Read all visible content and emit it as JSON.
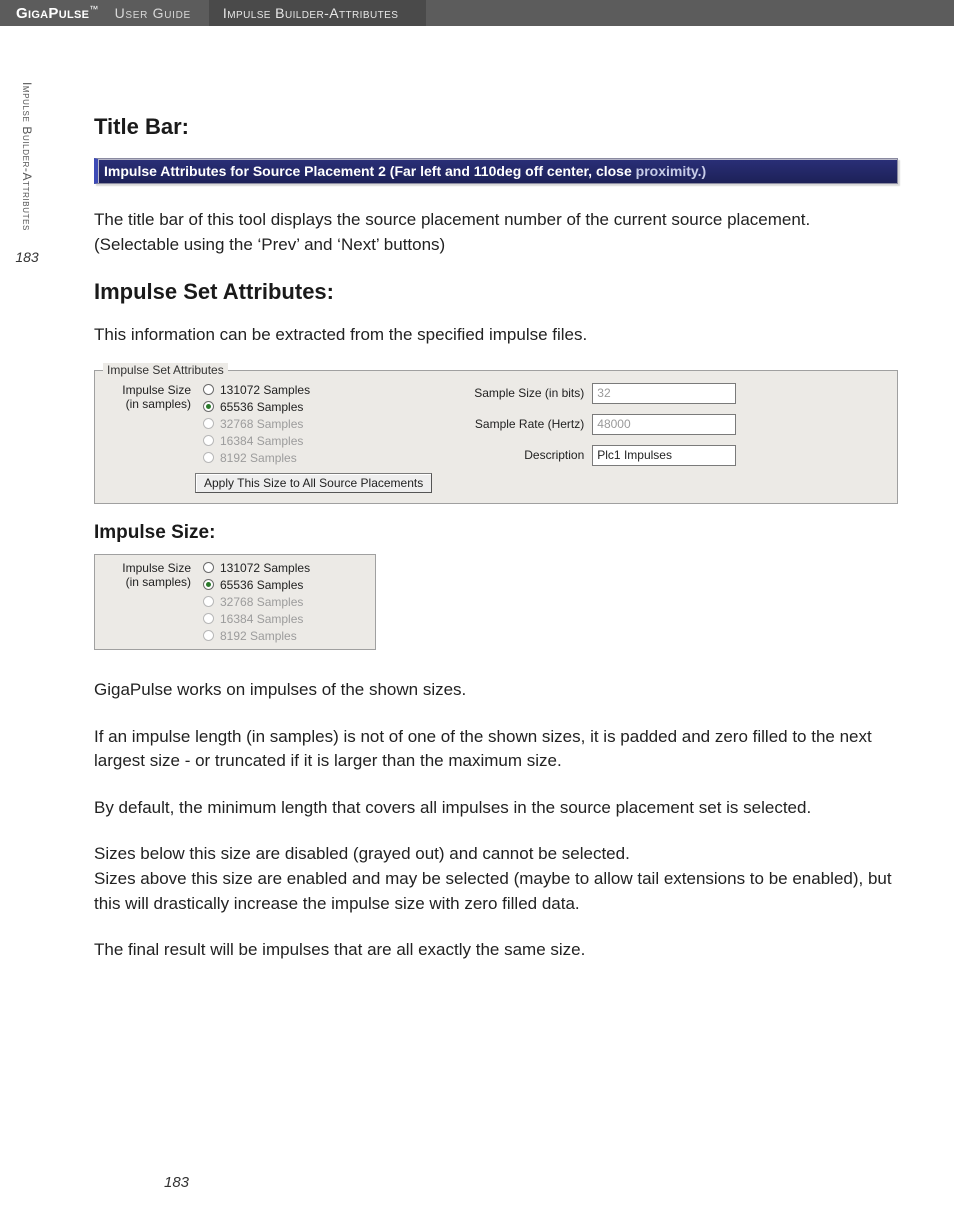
{
  "header": {
    "brand": "GigaPulse",
    "brand_tm": "™",
    "section": "User Guide",
    "crumb": "Impulse Builder-Attributes"
  },
  "gutter": {
    "label": "Impulse Builder-Attributes",
    "page_num": "183"
  },
  "title_bar_section": {
    "heading": "Title Bar:",
    "bar_text_a": "Impulse Attributes for Source Placement 2 (Far left and 110deg off center, close ",
    "bar_text_b": "proximity.)",
    "desc": "The title bar of this tool displays the source placement number of the current source placement. (Selectable using the ‘Prev’ and ‘Next’ buttons)"
  },
  "impulse_set_attr_section": {
    "heading": "Impulse Set Attributes:",
    "intro": "This information can be extracted from the specified impulse files.",
    "groupbox_legend": "Impulse Set Attributes",
    "size_label_line1": "Impulse Size",
    "size_label_line2": "(in samples)",
    "radios": [
      {
        "label": "131072 Samples",
        "selected": false,
        "disabled": false
      },
      {
        "label": "65536 Samples",
        "selected": true,
        "disabled": false
      },
      {
        "label": "32768 Samples",
        "selected": false,
        "disabled": true
      },
      {
        "label": "16384 Samples",
        "selected": false,
        "disabled": true
      },
      {
        "label": "8192 Samples",
        "selected": false,
        "disabled": true
      }
    ],
    "apply_button": "Apply This Size to All Source Placements",
    "field_sample_size_label": "Sample Size (in bits)",
    "field_sample_size_value": "32",
    "field_sample_rate_label": "Sample Rate (Hertz)",
    "field_sample_rate_value": "48000",
    "field_description_label": "Description",
    "field_description_value": "Plc1 Impulses"
  },
  "impulse_size_section": {
    "heading": "Impulse Size:",
    "size_label_line1": "Impulse Size",
    "size_label_line2": "(in samples)",
    "radios": [
      {
        "label": "131072 Samples",
        "selected": false,
        "disabled": false
      },
      {
        "label": "65536 Samples",
        "selected": true,
        "disabled": false
      },
      {
        "label": "32768 Samples",
        "selected": false,
        "disabled": true
      },
      {
        "label": "16384 Samples",
        "selected": false,
        "disabled": true
      },
      {
        "label": "8192 Samples",
        "selected": false,
        "disabled": true
      }
    ],
    "p1": "GigaPulse works on impulses of the shown sizes.",
    "p2": "If an impulse length (in samples) is not of one of the shown sizes, it is padded and zero filled to the next largest size - or truncated if it is larger than the maximum size.",
    "p3": "By default, the minimum length that covers all impulses in the source placement set is selected.",
    "p4a": "Sizes below this size are disabled (grayed out) and cannot be selected.",
    "p4b": "Sizes above this size are enabled and may be selected (maybe to allow tail extensions to be enabled), but this will drastically increase the impulse size with zero filled data.",
    "p5": "The final result will be impulses that are all exactly the same size."
  },
  "footer": {
    "page_num": "183"
  }
}
